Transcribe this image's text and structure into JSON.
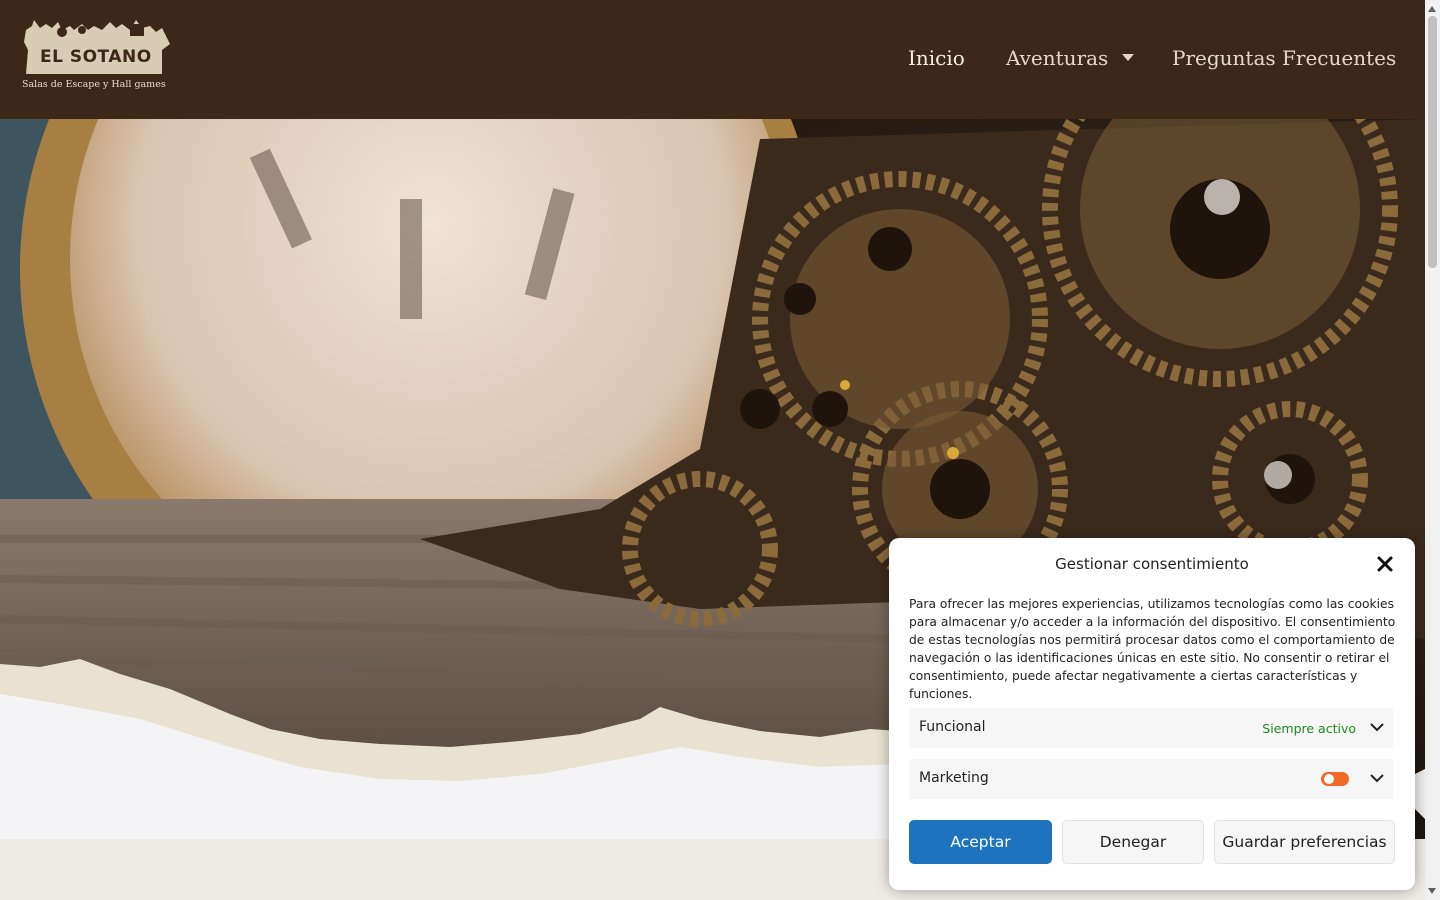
{
  "brand": {
    "name": "EL SOTANO",
    "tagline": "Salas de Escape y Hall games"
  },
  "nav": {
    "items": [
      {
        "label": "Inicio",
        "active": true
      },
      {
        "label": "Aventuras",
        "has_dropdown": true
      },
      {
        "label": "Preguntas Frecuentes"
      }
    ]
  },
  "colors": {
    "header_bg": "#3b2818",
    "accept_button": "#1e73be",
    "always_active": "#1e8a1e",
    "toggle_on": "#f06a25"
  },
  "consent": {
    "title": "Gestionar consentimiento",
    "body": "Para ofrecer las mejores experiencias, utilizamos tecnologías como las cookies para almacenar y/o acceder a la información del dispositivo. El consentimiento de estas tecnologías nos permitirá procesar datos como el comportamiento de navegación o las identificaciones únicas en este sitio. No consentir o retirar el consentimiento, puede afectar negativamente a ciertas características y funciones.",
    "categories": [
      {
        "label": "Funcional",
        "status": "Siempre activo"
      },
      {
        "label": "Marketing",
        "toggle": "on"
      }
    ],
    "buttons": {
      "accept": "Aceptar",
      "deny": "Denegar",
      "save": "Guardar preferencias"
    }
  }
}
